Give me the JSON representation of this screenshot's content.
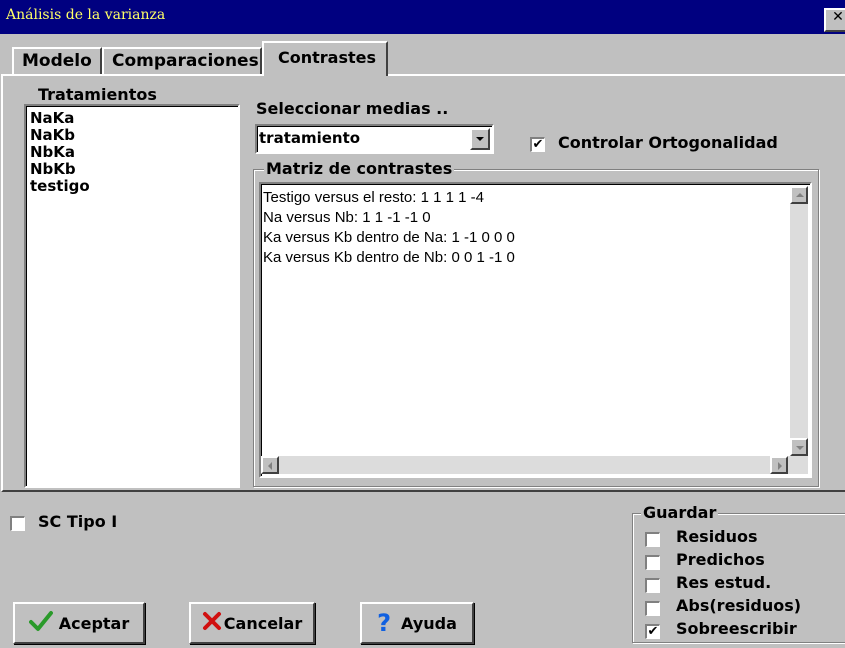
{
  "window": {
    "title": "Análisis de la varianza",
    "close_glyph": "✕"
  },
  "tabs": [
    {
      "label": "Modelo"
    },
    {
      "label": "Comparaciones"
    },
    {
      "label": "Contrastes"
    }
  ],
  "tratamientos": {
    "label": "Tratamientos",
    "items": [
      "NaKa",
      "NaKb",
      "NbKa",
      "NbKb",
      "testigo"
    ]
  },
  "seleccionar": {
    "label": "Seleccionar medias ..",
    "value": "tratamiento"
  },
  "controlar_ortogonalidad": {
    "label": "Controlar Ortogonalidad",
    "checked": true
  },
  "matriz": {
    "label": "Matriz de contrastes",
    "lines": [
      "Testigo versus el resto: 1 1 1 1 -4",
      "Na versus Nb: 1 1 -1 -1 0",
      "Ka versus Kb dentro de Na: 1 -1 0 0 0",
      "Ka versus Kb dentro de Nb: 0 0 1 -1 0"
    ]
  },
  "sc_tipo": {
    "label": "SC Tipo I",
    "checked": false
  },
  "guardar": {
    "label": "Guardar",
    "options": [
      {
        "label": "Residuos",
        "checked": false
      },
      {
        "label": "Predichos",
        "checked": false
      },
      {
        "label": "Res estud.",
        "checked": false
      },
      {
        "label": "Abs(residuos)",
        "checked": false
      },
      {
        "label": "Sobreescribir",
        "checked": true
      }
    ]
  },
  "buttons": {
    "aceptar": "Aceptar",
    "cancelar": "Cancelar",
    "ayuda": "Ayuda"
  },
  "colors": {
    "titlebar": "#000080",
    "title_text": "#ffff66",
    "face": "#c0c0c0",
    "ok_icon": "#2a9a2a",
    "cancel_icon": "#d01010",
    "help_icon": "#1060e0"
  }
}
